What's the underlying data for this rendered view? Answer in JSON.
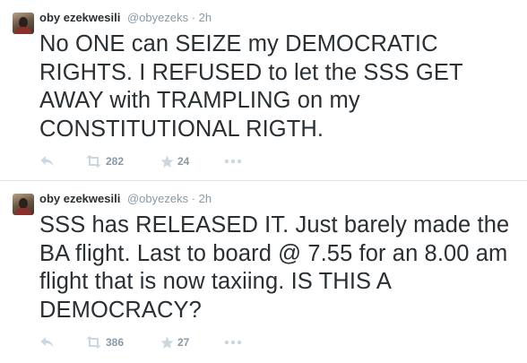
{
  "tweets": [
    {
      "name": "oby ezekwesili",
      "handle": "@obyezeks",
      "time": "2h",
      "text": "No ONE can SEIZE my DEMOCRATIC RIGHTS. I REFUSED to let the SSS GET AWAY with TRAMPLING on my CONSTITUTIONAL RIGTH.",
      "retweets": "282",
      "favorites": "24"
    },
    {
      "name": "oby ezekwesili",
      "handle": "@obyezeks",
      "time": "2h",
      "text": "SSS has RELEASED IT. Just barely made the BA flight. Last to board @ 7.55 for an 8.00 am flight that is now taxiing. IS THIS A DEMOCRACY?",
      "retweets": "386",
      "favorites": "27"
    }
  ],
  "separator": "·",
  "icons": {
    "reply": "reply-icon",
    "retweet": "retweet-icon",
    "favorite": "star-icon",
    "more": "more-icon"
  },
  "colors": {
    "text": "#292f33",
    "muted": "#8899a6",
    "icon": "#ccd6dd",
    "divider": "#e1e8ed"
  }
}
